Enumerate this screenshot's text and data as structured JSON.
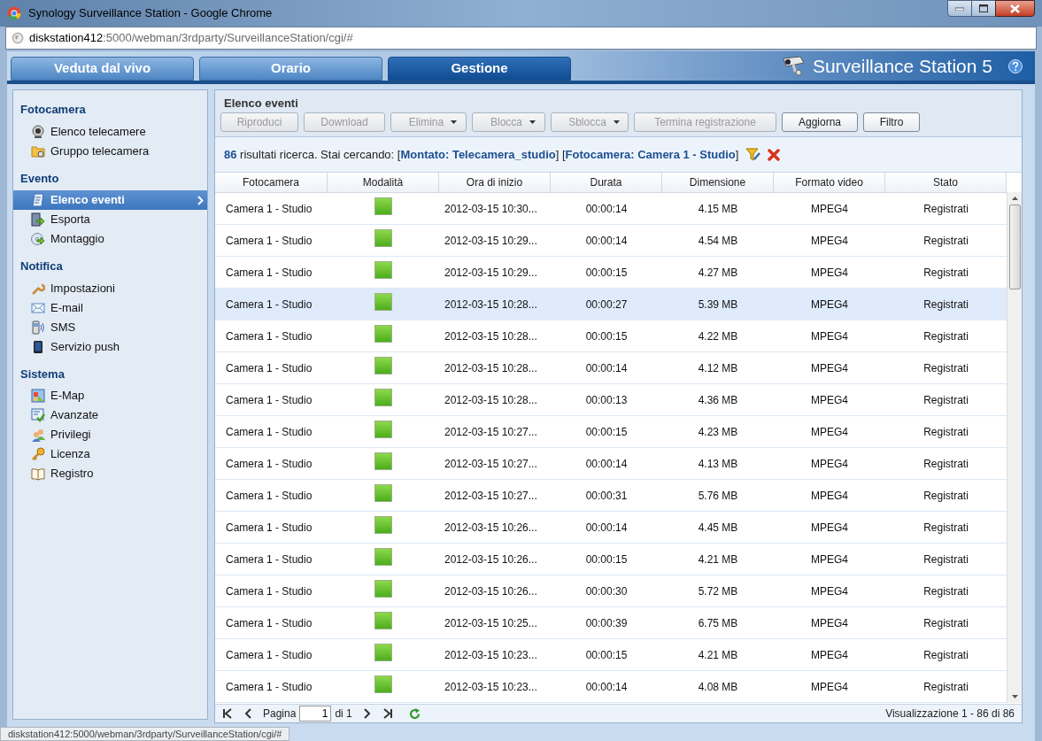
{
  "window": {
    "title": "Synology Surveillance Station - Google Chrome"
  },
  "address_bar": {
    "host": "diskstation412",
    "path": ":5000/webman/3rdparty/SurveillanceStation/cgi/#"
  },
  "tabs": [
    {
      "label": "Veduta dal vivo",
      "selected": false
    },
    {
      "label": "Orario",
      "selected": false
    },
    {
      "label": "Gestione",
      "selected": true
    }
  ],
  "app_title": "Surveillance Station 5",
  "sidebar": {
    "sections": [
      {
        "title": "Fotocamera",
        "items": [
          {
            "label": "Elenco telecamere",
            "selected": false
          },
          {
            "label": "Gruppo telecamera",
            "selected": false
          }
        ]
      },
      {
        "title": "Evento",
        "items": [
          {
            "label": "Elenco eventi",
            "selected": true
          },
          {
            "label": "Esporta",
            "selected": false
          },
          {
            "label": "Montaggio",
            "selected": false
          }
        ]
      },
      {
        "title": "Notifica",
        "items": [
          {
            "label": "Impostazioni",
            "selected": false
          },
          {
            "label": "E-mail",
            "selected": false
          },
          {
            "label": "SMS",
            "selected": false
          },
          {
            "label": "Servizio push",
            "selected": false
          }
        ]
      },
      {
        "title": "Sistema",
        "items": [
          {
            "label": "E-Map",
            "selected": false
          },
          {
            "label": "Avanzate",
            "selected": false
          },
          {
            "label": "Privilegi",
            "selected": false
          },
          {
            "label": "Licenza",
            "selected": false
          },
          {
            "label": "Registro",
            "selected": false
          }
        ]
      }
    ]
  },
  "panel_title": "Elenco eventi",
  "toolbar": [
    {
      "label": "Riproduci",
      "kind": "button",
      "disabled": true
    },
    {
      "label": "Download",
      "kind": "button",
      "disabled": true
    },
    {
      "label": "Elimina",
      "kind": "dropdown",
      "disabled": true
    },
    {
      "label": "Blocca",
      "kind": "dropdown",
      "disabled": true
    },
    {
      "label": "Sblocca",
      "kind": "dropdown",
      "disabled": true
    },
    {
      "label": "Termina registrazione",
      "kind": "button",
      "disabled": true
    },
    {
      "label": "Aggiorna",
      "kind": "button",
      "disabled": false
    },
    {
      "label": "Filtro",
      "kind": "button",
      "disabled": false
    }
  ],
  "search_summary": "**86** risultati ricerca. Stai cercando: [**Montato: Telecamera_studio**] [**Fotocamera: Camera 1 - Studio**]",
  "table": {
    "columns": [
      "Fotocamera",
      "Modalità",
      "Ora di inizio",
      "Durata",
      "Dimensione",
      "Formato video",
      "Stato"
    ],
    "rows": [
      {
        "camera": "Camera 1 - Studio",
        "start": "2012-03-15 10:30...",
        "duration": "00:00:14",
        "size": "4.15 MB",
        "format": "MPEG4",
        "status": "Registrati",
        "selected": false
      },
      {
        "camera": "Camera 1 - Studio",
        "start": "2012-03-15 10:29...",
        "duration": "00:00:14",
        "size": "4.54 MB",
        "format": "MPEG4",
        "status": "Registrati",
        "selected": false
      },
      {
        "camera": "Camera 1 - Studio",
        "start": "2012-03-15 10:29...",
        "duration": "00:00:15",
        "size": "4.27 MB",
        "format": "MPEG4",
        "status": "Registrati",
        "selected": false
      },
      {
        "camera": "Camera 1 - Studio",
        "start": "2012-03-15 10:28...",
        "duration": "00:00:27",
        "size": "5.39 MB",
        "format": "MPEG4",
        "status": "Registrati",
        "selected": true
      },
      {
        "camera": "Camera 1 - Studio",
        "start": "2012-03-15 10:28...",
        "duration": "00:00:15",
        "size": "4.22 MB",
        "format": "MPEG4",
        "status": "Registrati",
        "selected": false
      },
      {
        "camera": "Camera 1 - Studio",
        "start": "2012-03-15 10:28...",
        "duration": "00:00:14",
        "size": "4.12 MB",
        "format": "MPEG4",
        "status": "Registrati",
        "selected": false
      },
      {
        "camera": "Camera 1 - Studio",
        "start": "2012-03-15 10:28...",
        "duration": "00:00:13",
        "size": "4.36 MB",
        "format": "MPEG4",
        "status": "Registrati",
        "selected": false
      },
      {
        "camera": "Camera 1 - Studio",
        "start": "2012-03-15 10:27...",
        "duration": "00:00:15",
        "size": "4.23 MB",
        "format": "MPEG4",
        "status": "Registrati",
        "selected": false
      },
      {
        "camera": "Camera 1 - Studio",
        "start": "2012-03-15 10:27...",
        "duration": "00:00:14",
        "size": "4.13 MB",
        "format": "MPEG4",
        "status": "Registrati",
        "selected": false
      },
      {
        "camera": "Camera 1 - Studio",
        "start": "2012-03-15 10:27...",
        "duration": "00:00:31",
        "size": "5.76 MB",
        "format": "MPEG4",
        "status": "Registrati",
        "selected": false
      },
      {
        "camera": "Camera 1 - Studio",
        "start": "2012-03-15 10:26...",
        "duration": "00:00:14",
        "size": "4.45 MB",
        "format": "MPEG4",
        "status": "Registrati",
        "selected": false
      },
      {
        "camera": "Camera 1 - Studio",
        "start": "2012-03-15 10:26...",
        "duration": "00:00:15",
        "size": "4.21 MB",
        "format": "MPEG4",
        "status": "Registrati",
        "selected": false
      },
      {
        "camera": "Camera 1 - Studio",
        "start": "2012-03-15 10:26...",
        "duration": "00:00:30",
        "size": "5.72 MB",
        "format": "MPEG4",
        "status": "Registrati",
        "selected": false
      },
      {
        "camera": "Camera 1 - Studio",
        "start": "2012-03-15 10:25...",
        "duration": "00:00:39",
        "size": "6.75 MB",
        "format": "MPEG4",
        "status": "Registrati",
        "selected": false
      },
      {
        "camera": "Camera 1 - Studio",
        "start": "2012-03-15 10:23...",
        "duration": "00:00:15",
        "size": "4.21 MB",
        "format": "MPEG4",
        "status": "Registrati",
        "selected": false
      },
      {
        "camera": "Camera 1 - Studio",
        "start": "2012-03-15 10:23...",
        "duration": "00:00:14",
        "size": "4.08 MB",
        "format": "MPEG4",
        "status": "Registrati",
        "selected": false
      }
    ]
  },
  "pager": {
    "page_label": "Pagina",
    "page": "1",
    "page_total": "di 1",
    "display_info": "Visualizzazione 1 - 86 di 86"
  },
  "status_bubble": "diskstation412:5000/webman/3rdparty/SurveillanceStation/cgi/#"
}
